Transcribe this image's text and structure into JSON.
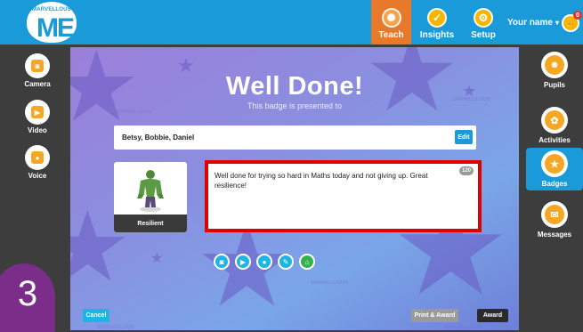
{
  "logo": {
    "tiny_text": "MARVELLOUS",
    "big_text": "ME"
  },
  "nav": [
    {
      "label": "Teach",
      "icon": "teach-icon",
      "glyph": "✺"
    },
    {
      "label": "Insights",
      "icon": "check-icon",
      "glyph": "✓"
    },
    {
      "label": "Setup",
      "icon": "gear-icon",
      "glyph": "⚙"
    }
  ],
  "user": {
    "name": "Your name",
    "chevron": "▾",
    "notifications": "0",
    "avatar_glyph": "✌"
  },
  "left_tools": [
    {
      "label": "Camera",
      "icon": "camera-icon",
      "glyph": "◙"
    },
    {
      "label": "Video",
      "icon": "video-icon",
      "glyph": "▶"
    },
    {
      "label": "Voice",
      "icon": "microphone-icon",
      "glyph": "●"
    }
  ],
  "right_nav": [
    {
      "label": "Pupils",
      "icon": "pupils-icon",
      "glyph": "☻"
    },
    {
      "label": "Activities",
      "icon": "activities-icon",
      "glyph": "✿"
    },
    {
      "label": "Badges",
      "icon": "badges-icon",
      "glyph": "★"
    },
    {
      "label": "Messages",
      "icon": "messages-icon",
      "glyph": "✉"
    }
  ],
  "award": {
    "title": "Well Done!",
    "subtitle": "This badge is presented to",
    "pupils": "Betsy, Bobbie, Daniel",
    "edit_label": "Edit",
    "badge_name": "Resilient",
    "message": "Well done for trying so hard in Maths today and not giving up. Great resilience!",
    "char_count": "120",
    "watermark": "MARVELLOUS",
    "attachments": [
      {
        "icon": "camera-attach-icon",
        "glyph": "◙"
      },
      {
        "icon": "video-attach-icon",
        "glyph": "▶"
      },
      {
        "icon": "voice-attach-icon",
        "glyph": "●"
      },
      {
        "icon": "paperclip-icon",
        "glyph": "✎"
      },
      {
        "icon": "home-check-icon",
        "glyph": "⌂"
      }
    ],
    "cancel_label": "Cancel",
    "print_award_label": "Print & Award",
    "award_label": "Award"
  },
  "step_number": "3",
  "colors": {
    "topbar": "#1a9ad8",
    "teach_active": "#e8782a",
    "highlight": "#e00000",
    "background": "#3d3d3d"
  }
}
